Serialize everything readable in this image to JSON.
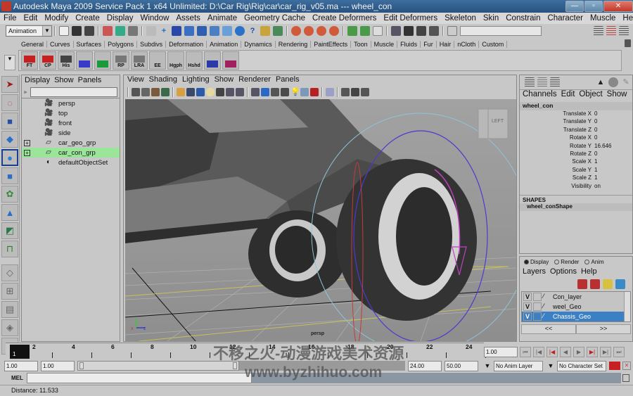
{
  "window": {
    "title": "Autodesk Maya 2009 Service Pack 1 x64 Unlimited: D:\\Car Rig\\Rig\\car\\car_rig_v05.ma   ---   wheel_con",
    "minimize": "—",
    "maximize": "▫",
    "close": "✕"
  },
  "menubar": [
    "File",
    "Edit",
    "Modify",
    "Create",
    "Display",
    "Window",
    "Assets",
    "Animate",
    "Geometry Cache",
    "Create Deformers",
    "Edit Deformers",
    "Skeleton",
    "Skin",
    "Constrain",
    "Character",
    "Muscle",
    "Help"
  ],
  "statusline": {
    "menuset": "Animation"
  },
  "shelf": {
    "tabs": [
      "General",
      "Curves",
      "Surfaces",
      "Polygons",
      "Subdivs",
      "Deformation",
      "Animation",
      "Dynamics",
      "Rendering",
      "PaintEffects",
      "Toon",
      "Muscle",
      "Fluids",
      "Fur",
      "Hair",
      "nCloth",
      "Custom"
    ],
    "buttons": [
      "FT",
      "CP",
      "His",
      "",
      "",
      "RP",
      "LRA",
      "EE",
      "Hgph",
      "Hshd",
      "",
      ""
    ]
  },
  "outliner": {
    "menu": [
      "Display",
      "Show",
      "Panels"
    ],
    "items": [
      {
        "label": "persp",
        "icon": "camera-icon",
        "expandable": false,
        "selected": false
      },
      {
        "label": "top",
        "icon": "camera-icon",
        "expandable": false,
        "selected": false
      },
      {
        "label": "front",
        "icon": "camera-icon",
        "expandable": false,
        "selected": false
      },
      {
        "label": "side",
        "icon": "camera-icon",
        "expandable": false,
        "selected": false
      },
      {
        "label": "car_geo_grp",
        "icon": "group-icon",
        "expandable": true,
        "selected": false
      },
      {
        "label": "car_con_grp",
        "icon": "group-icon",
        "expandable": true,
        "selected": true
      },
      {
        "label": "defaultObjectSet",
        "icon": "set-icon",
        "expandable": false,
        "selected": false
      }
    ]
  },
  "viewport": {
    "menu": [
      "View",
      "Shading",
      "Lighting",
      "Show",
      "Renderer",
      "Panels"
    ],
    "camera_label": "persp",
    "viewcube_label": "LEFT"
  },
  "channelbox": {
    "menu": [
      "Channels",
      "Edit",
      "Object",
      "Show"
    ],
    "object": "wheel_con",
    "channels": [
      {
        "name": "Translate X",
        "value": "0"
      },
      {
        "name": "Translate Y",
        "value": "0"
      },
      {
        "name": "Translate Z",
        "value": "0"
      },
      {
        "name": "Rotate X",
        "value": "0"
      },
      {
        "name": "Rotate Y",
        "value": "16.646"
      },
      {
        "name": "Rotate Z",
        "value": "0"
      },
      {
        "name": "Scale X",
        "value": "1"
      },
      {
        "name": "Scale Y",
        "value": "1"
      },
      {
        "name": "Scale Z",
        "value": "1"
      },
      {
        "name": "Visibility",
        "value": "on"
      }
    ],
    "shapes_header": "SHAPES",
    "shape": "wheel_conShape"
  },
  "layers": {
    "modes": [
      {
        "label": "Display",
        "selected": true
      },
      {
        "label": "Render",
        "selected": false
      },
      {
        "label": "Anim",
        "selected": false
      }
    ],
    "menu": [
      "Layers",
      "Options",
      "Help"
    ],
    "items": [
      {
        "vis": "V",
        "name": "Con_layer",
        "selected": false
      },
      {
        "vis": "V",
        "name": "weel_Geo",
        "selected": false
      },
      {
        "vis": "V",
        "name": "Chassis_Geo",
        "selected": true
      }
    ],
    "prev": "<<",
    "next": ">>"
  },
  "timeline": {
    "current_frame": "1",
    "ticks": [
      "2",
      "4",
      "6",
      "8",
      "10",
      "12",
      "14",
      "16",
      "18",
      "20",
      "22",
      "24"
    ],
    "current_time": "1.00",
    "range_start": "1.00",
    "playback_start": "1.00",
    "playback_end": "24.00",
    "range_end": "50.00",
    "anim_layer": "No Anim Layer",
    "character_set": "No Character Set"
  },
  "cmdline": {
    "label": "MEL"
  },
  "helpline": {
    "text": "Distance:  11.533"
  },
  "watermark": {
    "line1": "不移之火-动漫游戏美术资源",
    "line2": "www.byzhihuo.com"
  }
}
